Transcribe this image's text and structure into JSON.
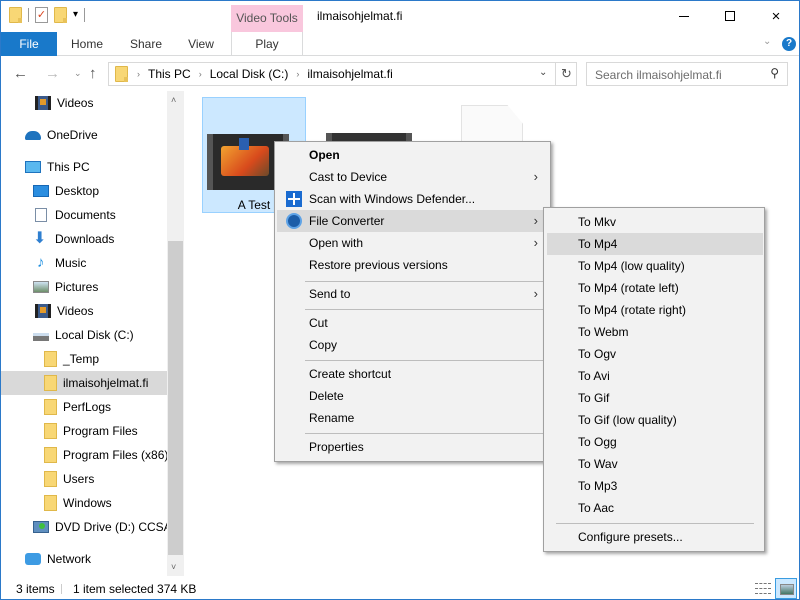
{
  "window": {
    "title": "ilmaisohjelmat.fi",
    "context_tab_group": "Video Tools",
    "controls": {
      "minimize": "minimize",
      "maximize": "maximize",
      "close": "×"
    }
  },
  "quick_access_toolbar": {
    "icons": [
      "folder-icon",
      "properties-icon",
      "new-folder-icon",
      "customize-dropdown-icon"
    ],
    "dropdown_glyph": "▾"
  },
  "ribbon": {
    "tabs": [
      {
        "label": "File",
        "active": true
      },
      {
        "label": "Home"
      },
      {
        "label": "Share"
      },
      {
        "label": "View"
      },
      {
        "label": "Play"
      }
    ],
    "collapse_glyph": "⌄",
    "help_glyph": "?"
  },
  "navigation": {
    "back_glyph": "←",
    "forward_glyph": "→",
    "recent_glyph": "⌄",
    "up_glyph": "↑",
    "breadcrumb": [
      "This PC",
      "Local Disk (C:)",
      "ilmaisohjelmat.fi"
    ],
    "breadcrumb_sep": "›",
    "dropdown_glyph": "⌄",
    "refresh_glyph": "↻",
    "search": {
      "placeholder": "Search ilmaisohjelmat.fi",
      "icon_glyph": "⚲"
    }
  },
  "sidebar": {
    "items": [
      {
        "label": "Videos",
        "icon": "video-icon",
        "indent": 1
      },
      {
        "label": "OneDrive",
        "icon": "onedrive-icon",
        "indent": 0
      },
      {
        "label": "This PC",
        "icon": "this-pc-icon",
        "indent": 0
      },
      {
        "label": "Desktop",
        "icon": "desktop-icon",
        "indent": 1
      },
      {
        "label": "Documents",
        "icon": "documents-icon",
        "indent": 1
      },
      {
        "label": "Downloads",
        "icon": "downloads-icon",
        "indent": 1
      },
      {
        "label": "Music",
        "icon": "music-icon",
        "indent": 1
      },
      {
        "label": "Pictures",
        "icon": "pictures-icon",
        "indent": 1
      },
      {
        "label": "Videos",
        "icon": "video-icon",
        "indent": 1
      },
      {
        "label": "Local Disk (C:)",
        "icon": "local-disk-icon",
        "indent": 1
      },
      {
        "label": "_Temp",
        "icon": "folder-icon",
        "indent": 2
      },
      {
        "label": "ilmaisohjelmat.fi",
        "icon": "folder-icon",
        "indent": 2,
        "selected": true
      },
      {
        "label": "PerfLogs",
        "icon": "folder-icon",
        "indent": 2
      },
      {
        "label": "Program Files",
        "icon": "folder-icon",
        "indent": 2
      },
      {
        "label": "Program Files (x86)",
        "icon": "folder-icon",
        "indent": 2
      },
      {
        "label": "Users",
        "icon": "folder-icon",
        "indent": 2
      },
      {
        "label": "Windows",
        "icon": "folder-icon",
        "indent": 2
      },
      {
        "label": "DVD Drive (D:) CCSA_",
        "icon": "dvd-drive-icon",
        "indent": 1
      },
      {
        "label": "Network",
        "icon": "network-icon",
        "indent": 0
      }
    ],
    "scroll_up_glyph": "˄",
    "scroll_down_glyph": "˅"
  },
  "files": [
    {
      "name": "A Test",
      "type": "video",
      "selected": true
    },
    {
      "name": "",
      "type": "video"
    },
    {
      "name": "",
      "type": "document"
    }
  ],
  "context_menu": {
    "items": [
      {
        "label": "Open",
        "bold": true
      },
      {
        "label": "Cast to Device",
        "submenu": true
      },
      {
        "label": "Scan with Windows Defender...",
        "icon": "windows-defender-icon"
      },
      {
        "label": "File Converter",
        "submenu": true,
        "icon": "file-converter-icon",
        "highlighted": true
      },
      {
        "label": "Open with",
        "submenu": true
      },
      {
        "label": "Restore previous versions"
      },
      {
        "separator": true
      },
      {
        "label": "Send to",
        "submenu": true
      },
      {
        "separator": true
      },
      {
        "label": "Cut"
      },
      {
        "label": "Copy"
      },
      {
        "separator": true
      },
      {
        "label": "Create shortcut"
      },
      {
        "label": "Delete"
      },
      {
        "label": "Rename"
      },
      {
        "separator": true
      },
      {
        "label": "Properties"
      }
    ],
    "submenu_arrow": "›"
  },
  "file_converter_submenu": {
    "items": [
      {
        "label": "To Mkv"
      },
      {
        "label": "To Mp4",
        "highlighted": true
      },
      {
        "label": "To Mp4 (low quality)"
      },
      {
        "label": "To Mp4 (rotate left)"
      },
      {
        "label": "To Mp4 (rotate right)"
      },
      {
        "label": "To Webm"
      },
      {
        "label": "To Ogv"
      },
      {
        "label": "To Avi"
      },
      {
        "label": "To Gif"
      },
      {
        "label": "To Gif (low quality)"
      },
      {
        "label": "To Ogg"
      },
      {
        "label": "To Wav"
      },
      {
        "label": "To Mp3"
      },
      {
        "label": "To Aac"
      },
      {
        "separator": true
      },
      {
        "label": "Configure presets..."
      }
    ]
  },
  "statusbar": {
    "item_count": "3 items",
    "selection": "1 item selected  374 KB",
    "view_modes": [
      "details-view",
      "large-icons-view"
    ],
    "active_view": "large-icons-view"
  },
  "colors": {
    "accent": "#1979ca",
    "context_tab": "#f9c7dd",
    "selection_fill": "#cce8ff",
    "menu_bg": "#f2f2f2",
    "menu_hover": "#dadada"
  }
}
